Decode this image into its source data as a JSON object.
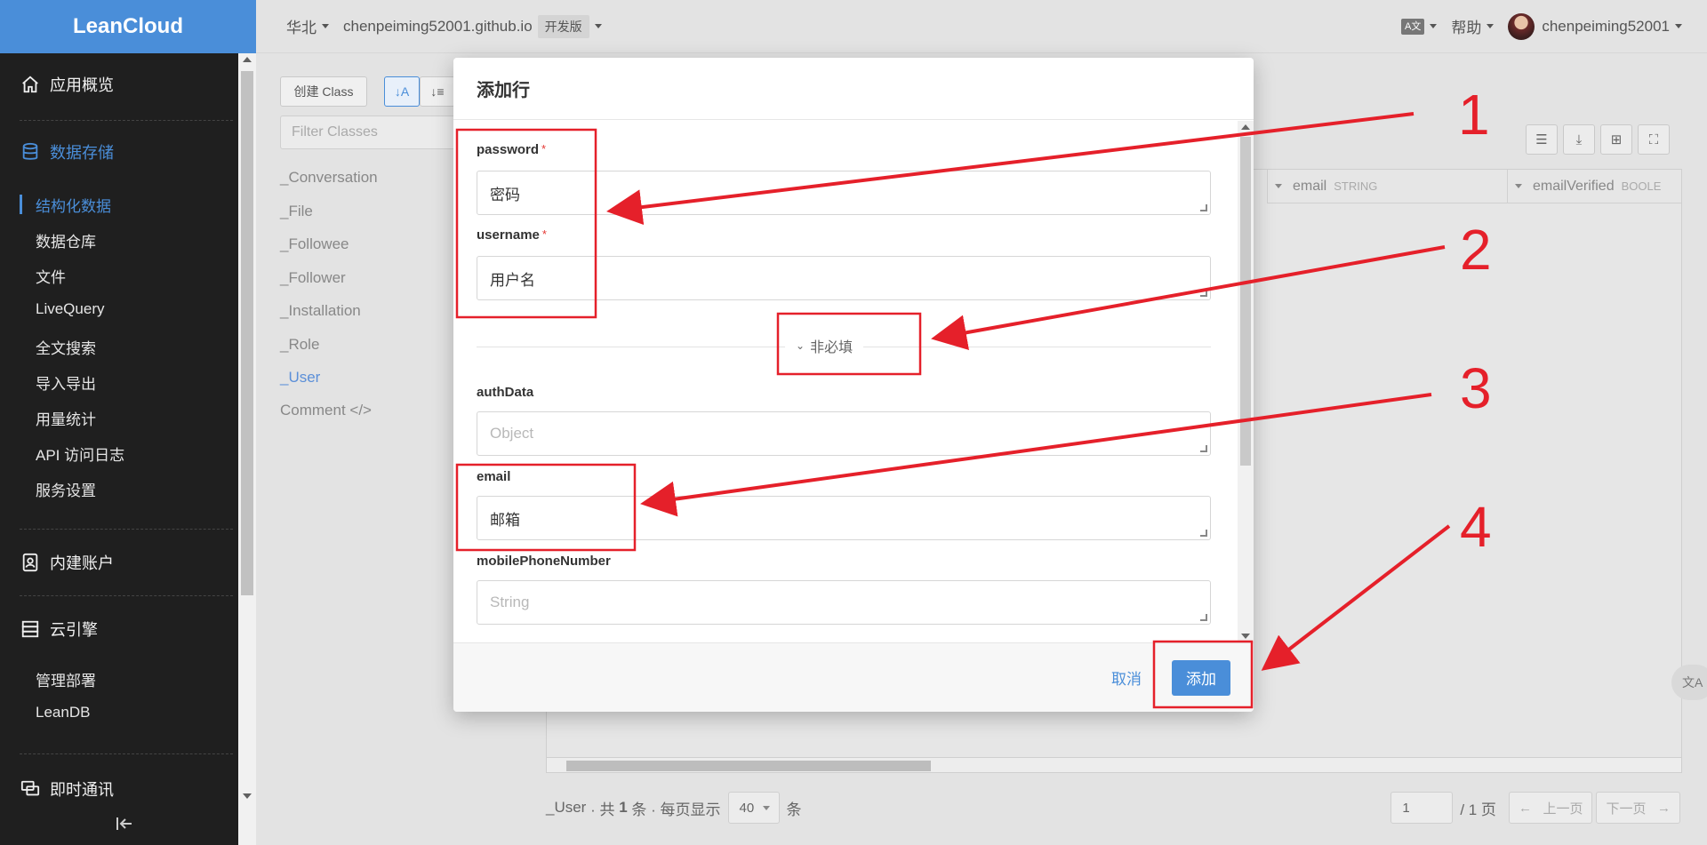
{
  "app": {
    "logo": "LeanCloud"
  },
  "topbar": {
    "region": "华北",
    "app_name": "chenpeiming52001.github.io",
    "plan_badge": "开发版",
    "lang_icon": "A文",
    "help": "帮助",
    "username": "chenpeiming52001"
  },
  "sidebar": {
    "overview": "应用概览",
    "storage": "数据存储",
    "storage_items": [
      "结构化数据",
      "数据仓库",
      "文件",
      "LiveQuery",
      "全文搜索",
      "导入导出",
      "用量统计",
      "API 访问日志",
      "服务设置"
    ],
    "accounts": "内建账户",
    "cloud": "云引擎",
    "cloud_items": [
      "管理部署",
      "LeanDB"
    ],
    "im": "即时通讯",
    "collapse_icon": "collapse-left-icon"
  },
  "classpanel": {
    "create_button": "创建 Class",
    "sort_asc_icon": "↓A",
    "sort_desc_icon": "↓≡",
    "filter_placeholder": "Filter Classes",
    "classes": [
      "_Conversation",
      "_File",
      "_Followee",
      "_Follower",
      "_Installation",
      "_Role",
      "_User"
    ],
    "comment": "Comment </>",
    "active_class": "_User"
  },
  "grid": {
    "columns": [
      {
        "name": "email",
        "type": "STRING"
      },
      {
        "name": "emailVerified",
        "type": "BOOLE"
      }
    ]
  },
  "footer": {
    "class_label": "_User",
    "total_prefix": "· 共",
    "total_count": "1",
    "total_suffix": "条 · 每页显示",
    "page_size": "40",
    "page_size_unit": "条",
    "page_input": "1",
    "page_total": "/ 1 页",
    "prev": "上一页",
    "next": "下一页"
  },
  "modal": {
    "title": "添加行",
    "fields_required": [
      {
        "label": "password",
        "value": "密码"
      },
      {
        "label": "username",
        "value": "用户名"
      }
    ],
    "optional_toggle": "非必填",
    "fields_optional": [
      {
        "label": "authData",
        "placeholder": "Object"
      },
      {
        "label": "email",
        "value": "邮箱"
      },
      {
        "label": "mobilePhoneNumber",
        "placeholder": "String"
      }
    ],
    "cancel": "取消",
    "submit": "添加"
  },
  "floating_button": "文A",
  "annotations": {
    "numbers": [
      "1",
      "2",
      "3",
      "4"
    ],
    "color": "#e5202a"
  },
  "colors": {
    "brand": "#4a8ed9",
    "sidebar_bg": "#1f1f1f",
    "required": "#e53935"
  }
}
